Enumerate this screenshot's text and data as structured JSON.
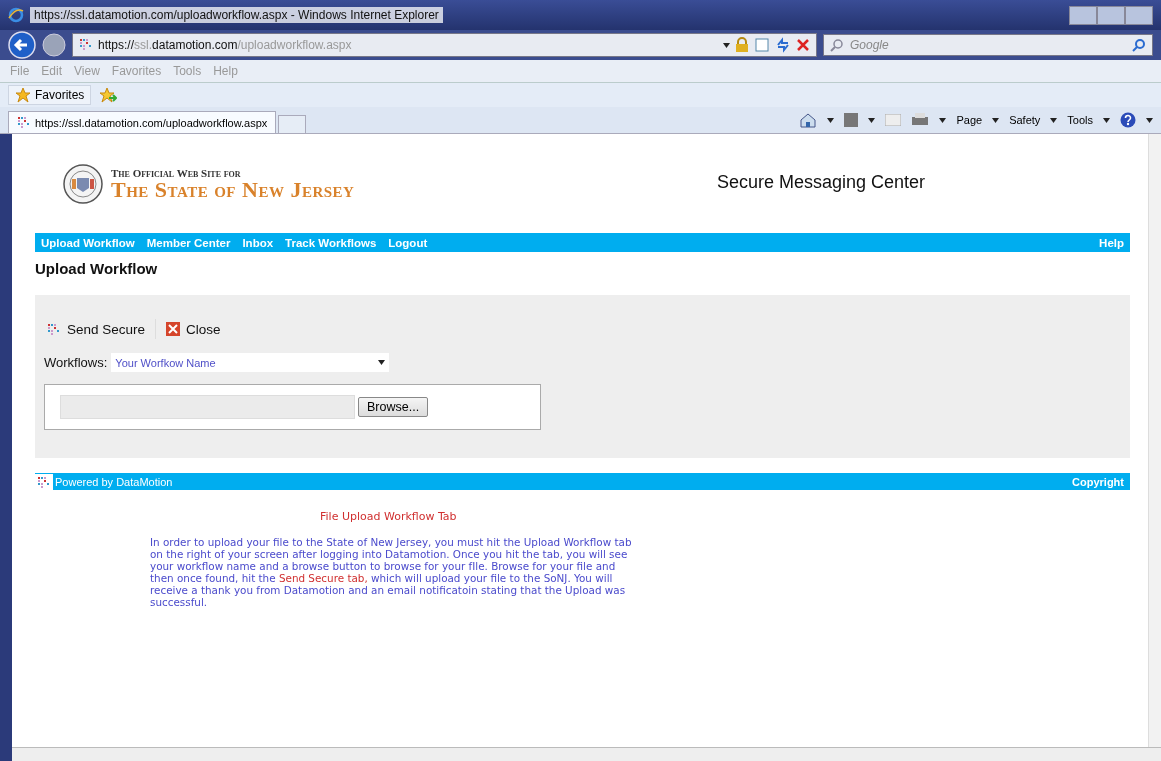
{
  "window": {
    "title": "https://ssl.datamotion.com/uploadworkflow.aspx - Windows Internet Explorer"
  },
  "address_bar": {
    "url_parts": [
      {
        "text": "https://",
        "emphasis": true
      },
      {
        "text": "ssl.",
        "emphasis": false
      },
      {
        "text": "datamotion.com",
        "emphasis": true
      },
      {
        "text": "/uploadworkflow.aspx",
        "emphasis": false
      }
    ]
  },
  "search": {
    "placeholder": "Google"
  },
  "menu": [
    "File",
    "Edit",
    "View",
    "Favorites",
    "Tools",
    "Help"
  ],
  "favorites_bar": {
    "button": "Favorites"
  },
  "tabs": [
    {
      "label": "https://ssl.datamotion.com/uploadworkflow.aspx",
      "selected": true
    }
  ],
  "command_bar": [
    "Page",
    "Safety",
    "Tools"
  ],
  "header": {
    "tagline": "The Official Web Site for",
    "site_name": "The State of New Jersey",
    "title": "Secure Messaging Center"
  },
  "nav": {
    "items": [
      "Upload Workflow",
      "Member Center",
      "Inbox",
      "Track Workflows",
      "Logout"
    ],
    "help": "Help"
  },
  "heading": "Upload Workflow",
  "toolbar": [
    {
      "label": "Send Secure",
      "kind": "send"
    },
    {
      "label": "Close",
      "kind": "close"
    }
  ],
  "workflows": {
    "label": "Workflows:",
    "value": "Your Worfkow Name"
  },
  "file_upload": {
    "button": "Browse..."
  },
  "footer": {
    "powered_by": "Powered by DataMotion",
    "copyright": "Copyright"
  },
  "instructions": {
    "title": "File Upload Workflow Tab",
    "parts": [
      {
        "text": "In order to upload your file to the State of New Jersey, you must hit the Upload Workflow tab on the right of your screen after logging into Datamotion. Once you hit the tab, you will see your workflow name and a browse button to browse for your fIle. Browse for your file and then once found, hit the ",
        "highlight": false
      },
      {
        "text": "Send Secure tab,",
        "highlight": true
      },
      {
        "text": " which will upload your file to the SoNJ. You will receive a thank you from Datamotion and an email notificatoin stating that the Upload was successful.",
        "highlight": false
      }
    ]
  }
}
